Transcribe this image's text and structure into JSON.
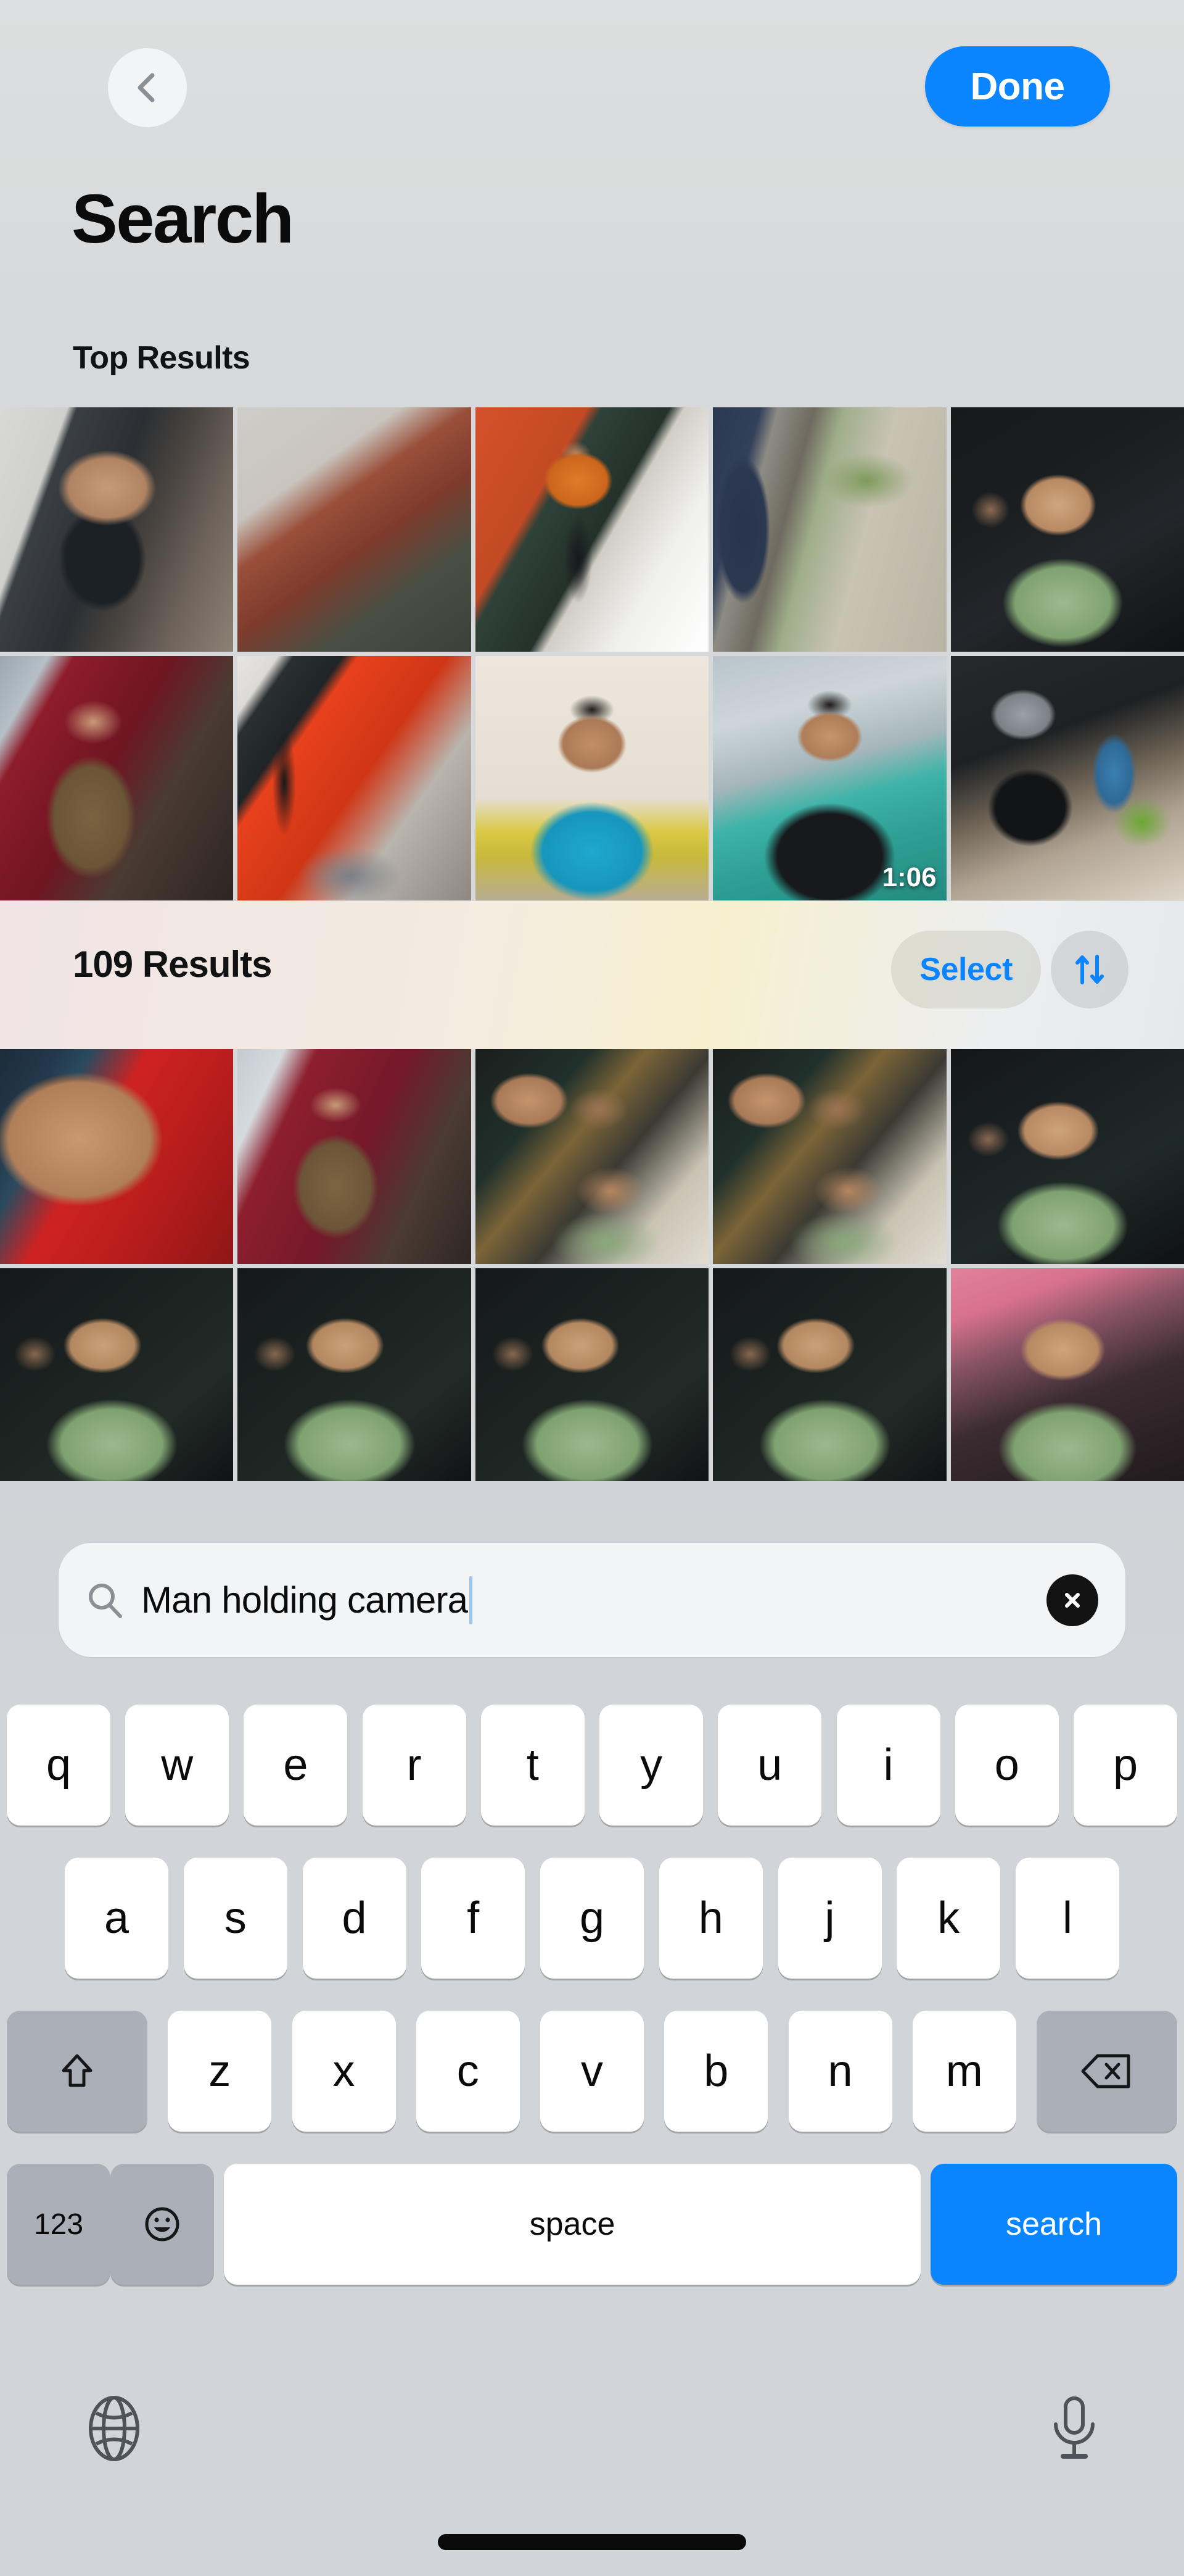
{
  "nav": {
    "back_icon": "chevron-left-icon",
    "done_label": "Done"
  },
  "header": {
    "title": "Search"
  },
  "top_results": {
    "heading": "Top Results",
    "photos": [
      {
        "id": "p1",
        "desc": "man in dark polo holding camera on stairs"
      },
      {
        "id": "p2",
        "desc": "man in orange shirt with camera, red wall, lens flare"
      },
      {
        "id": "p3",
        "desc": "man in orange shirt shooting camera on tripod, orange wall"
      },
      {
        "id": "p4",
        "desc": "person in striped shirt outdoors, paved courtyard"
      },
      {
        "id": "p5",
        "desc": "man in green shirt selfie, dark room"
      },
      {
        "id": "p6",
        "desc": "man in brown jacket, red wall studio"
      },
      {
        "id": "p7",
        "desc": "tripod and chalkboard in red studio, person lying"
      },
      {
        "id": "p8",
        "desc": "man in cyan polo seated, yellow cushion"
      },
      {
        "id": "p9",
        "desc": "man in black graphic tee, glass atrium",
        "duration": "1:06"
      },
      {
        "id": "p10",
        "desc": "Zenit film camera with flash on table"
      }
    ]
  },
  "results": {
    "count_label": "109 Results",
    "select_label": "Select",
    "sort_icon": "sort-arrows-icon",
    "photos": [
      {
        "id": "r1",
        "desc": "close-up man with glasses, red hoodie"
      },
      {
        "id": "r2",
        "desc": "man in brown jacket standing, red wall"
      },
      {
        "id": "r3",
        "desc": "two men, one in green shirt, dark room"
      },
      {
        "id": "r4",
        "desc": "two men, one in green shirt, dark room"
      },
      {
        "id": "r5",
        "desc": "man in green shirt with another man behind"
      },
      {
        "id": "r6",
        "desc": "man in green shirt, dark room"
      },
      {
        "id": "r7",
        "desc": "man in green shirt, dark room"
      },
      {
        "id": "r8",
        "desc": "man in green shirt, dark room"
      },
      {
        "id": "r9",
        "desc": "man in green shirt, dark room"
      },
      {
        "id": "r10",
        "desc": "man in green shirt, pink wall"
      }
    ]
  },
  "search": {
    "icon": "search-icon",
    "value": "Man holding camera",
    "placeholder": "Search",
    "clear_icon": "clear-circle-icon"
  },
  "keyboard": {
    "row1": [
      "q",
      "w",
      "e",
      "r",
      "t",
      "y",
      "u",
      "i",
      "o",
      "p"
    ],
    "row2": [
      "a",
      "s",
      "d",
      "f",
      "g",
      "h",
      "j",
      "k",
      "l"
    ],
    "row3": [
      "z",
      "x",
      "c",
      "v",
      "b",
      "n",
      "m"
    ],
    "shift_icon": "shift-arrow-icon",
    "delete_icon": "backspace-icon",
    "numbers_label": "123",
    "emoji_icon": "smiley-icon",
    "space_label": "space",
    "return_label": "search",
    "globe_icon": "globe-icon",
    "mic_icon": "microphone-icon"
  },
  "colors": {
    "accent_blue": "#0a84ff",
    "key_white": "#ffffff",
    "key_gray": "#abb0b8",
    "keyboard_bg": "#d1d4d8",
    "text_primary": "#0b0b0c"
  }
}
